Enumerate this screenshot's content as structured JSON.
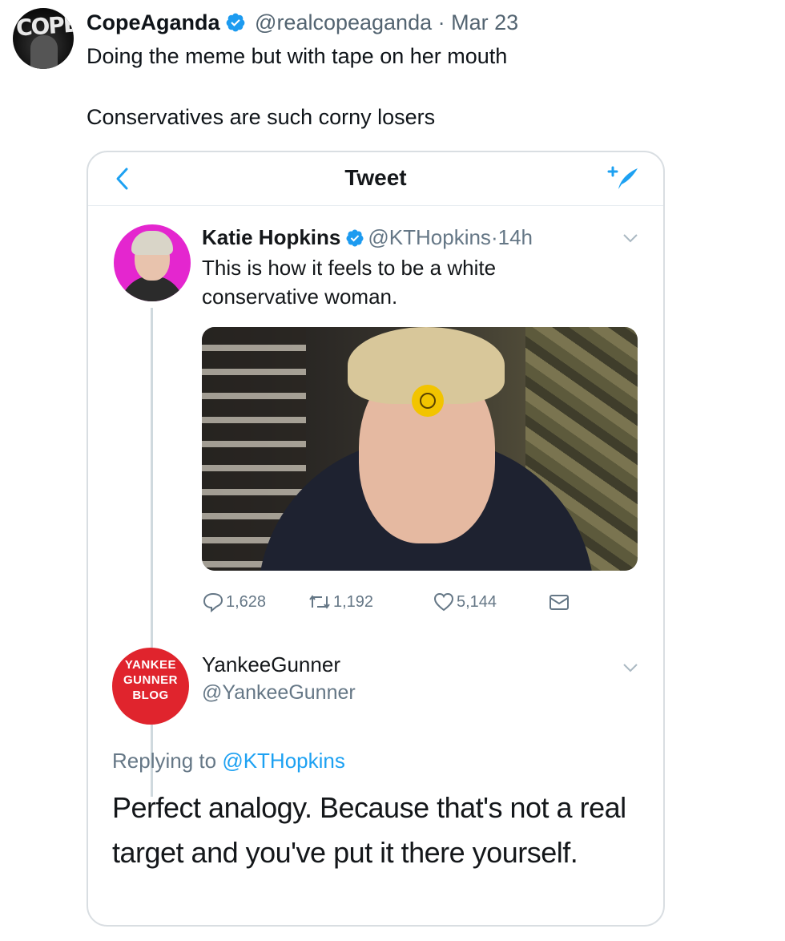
{
  "post": {
    "display_name": "CopeAganda",
    "handle": "@realcopeaganda",
    "separator": "·",
    "date": "Mar 23",
    "avatar_text": "COPE",
    "text_line1": "Doing the meme but with tape on her mouth",
    "text_line2": "Conservatives are such corny losers"
  },
  "embedded": {
    "header_title": "Tweet",
    "original_tweet": {
      "display_name": "Katie Hopkins",
      "handle": "@KTHopkins",
      "separator": "·",
      "time": "14h",
      "text": "This is how it feels to be a white conservative woman.",
      "replies": "1,628",
      "retweets": "1,192",
      "likes": "5,144"
    },
    "reply_tweet": {
      "display_name": "YankeeGunner",
      "handle": "@YankeeGunner",
      "avatar_lines": [
        "YANKEE",
        "GUNNER",
        "BLOG"
      ],
      "replying_prefix": "Replying to",
      "replying_mention": "@KTHopkins",
      "text": "Perfect analogy. Because that's not a real target and you've put it there yourself."
    }
  },
  "colors": {
    "verified_blue": "#1d9bf0",
    "link_blue": "#1da1f2",
    "yg_red": "#e0242d",
    "kh_magenta": "#e426cf"
  }
}
